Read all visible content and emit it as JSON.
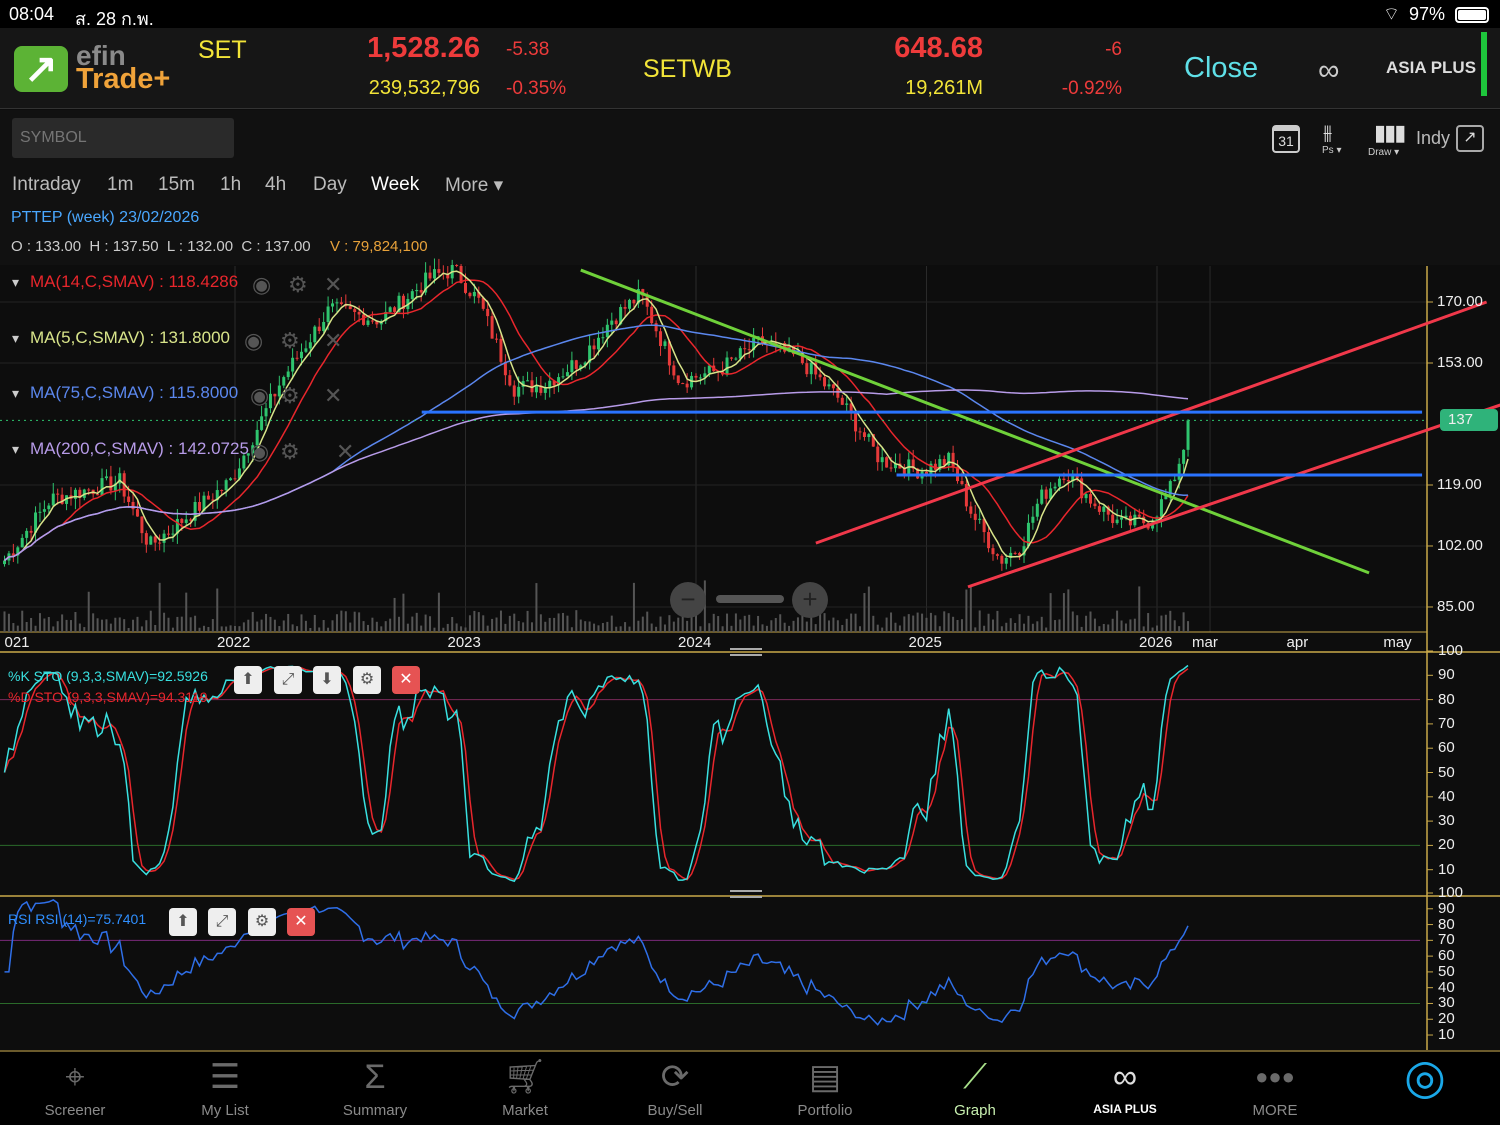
{
  "status_bar": {
    "time": "08:04",
    "date": "ส. 28 ก.พ.",
    "battery": "97%"
  },
  "header": {
    "logo_top": "efin",
    "logo_bottom": "Trade+",
    "set": {
      "label": "SET",
      "value": "1,528.26",
      "change": "-5.38",
      "volume": "239,532,796",
      "percent": "-0.35%"
    },
    "setwb": {
      "label": "SETWB",
      "value": "648.68",
      "change": "-6",
      "volume": "19,261M",
      "percent": "-0.92%"
    },
    "market_status": "Close",
    "broker_logo": "ASIA PLUS"
  },
  "toolbar": {
    "symbol_placeholder": "SYMBOL",
    "calendar_day": "31",
    "ps_label": "Ps ▾",
    "draw_label": "Draw ▾",
    "indy_label": "Indy",
    "timeframes": [
      "Intraday",
      "1m",
      "15m",
      "1h",
      "4h",
      "Day",
      "Week",
      "More ▾"
    ],
    "active_timeframe": "Week"
  },
  "info": {
    "title": "PTTEP (week) 23/02/2026",
    "ohlc": "O : 133.00  H : 137.50  L : 132.00  C : 137.00",
    "volume": "V : 79,824,100"
  },
  "colors": {
    "up": "#2fc46e",
    "down": "#e63a3a",
    "ma14": "#e8262c",
    "ma5": "#d8e48a",
    "ma75": "#5b87ee",
    "ma200": "#b79be8",
    "trend_green": "#6fd13a",
    "trend_red": "#f0384a",
    "level_blue": "#2a73ff",
    "stoK": "#39e0e0",
    "stoD": "#e8262c",
    "rsi": "#2f6fe8",
    "axis": "#c9a94a"
  },
  "chart_data": [
    {
      "type": "candlestick",
      "title": "PTTEP (week)",
      "ylim": [
        80,
        180
      ],
      "yticks": [
        "170.00",
        "153.00",
        "119.00",
        "102.00",
        "85.00"
      ],
      "ytick_values": [
        170,
        153,
        119,
        102,
        85
      ],
      "xticks": [
        "021",
        "2022",
        "2023",
        "2024",
        "2025",
        "2026",
        "mar",
        "apr",
        "may"
      ],
      "xtick_values": [
        2021.0,
        2022,
        2023,
        2024,
        2025,
        2026,
        2026.23,
        2026.64,
        2027.06
      ],
      "last_price_label": "137",
      "close_keypoints": [
        [
          2021.0,
          98
        ],
        [
          2021.2,
          115
        ],
        [
          2021.5,
          120
        ],
        [
          2021.63,
          102
        ],
        [
          2021.98,
          120
        ],
        [
          2022.2,
          148
        ],
        [
          2022.41,
          168
        ],
        [
          2022.63,
          165
        ],
        [
          2022.85,
          177
        ],
        [
          2022.95,
          179
        ],
        [
          2023.06,
          170
        ],
        [
          2023.21,
          146
        ],
        [
          2023.34,
          147
        ],
        [
          2023.5,
          154
        ],
        [
          2023.63,
          165
        ],
        [
          2023.76,
          172
        ],
        [
          2023.93,
          148
        ],
        [
          2024.1,
          151
        ],
        [
          2024.28,
          159
        ],
        [
          2024.45,
          154
        ],
        [
          2024.62,
          143
        ],
        [
          2024.8,
          126
        ],
        [
          2024.97,
          123
        ],
        [
          2025.1,
          126
        ],
        [
          2025.19,
          112
        ],
        [
          2025.32,
          98
        ],
        [
          2025.41,
          102
        ],
        [
          2025.49,
          115
        ],
        [
          2025.6,
          123
        ],
        [
          2025.71,
          115
        ],
        [
          2025.84,
          108
        ],
        [
          2025.97,
          109
        ],
        [
          2026.06,
          118
        ],
        [
          2026.15,
          137
        ]
      ],
      "legend": [
        {
          "name": "MA(14,C,SMAV) : 118.4286",
          "period": 14,
          "color_key": "ma14"
        },
        {
          "name": "MA(5,C,SMAV) : 131.8000",
          "period": 5,
          "color_key": "ma5"
        },
        {
          "name": "MA(75,C,SMAV) : 115.8000",
          "period": 75,
          "color_key": "ma75"
        },
        {
          "name": "MA(200,C,SMAV) : 142.0725",
          "period": 200,
          "color_key": "ma200"
        }
      ],
      "trendlines": [
        {
          "color_key": "trend_green",
          "from": [
            2023.5,
            178.9
          ],
          "to": [
            2026.92,
            94.5
          ]
        },
        {
          "color_key": "trend_red",
          "from": [
            2024.52,
            102.8
          ],
          "to": [
            2027.43,
            170
          ]
        },
        {
          "color_key": "trend_red",
          "from": [
            2025.18,
            90.6
          ],
          "to": [
            2027.49,
            141.3
          ]
        },
        {
          "color_key": "level_blue",
          "from": [
            2022.81,
            139.3
          ],
          "to": [
            2027.15,
            139.3
          ]
        },
        {
          "color_key": "level_blue",
          "from": [
            2024.87,
            121.8
          ],
          "to": [
            2027.15,
            121.8
          ]
        }
      ]
    },
    {
      "type": "line",
      "title": "Stochastic",
      "legend": [
        "%K STO (9,3,3,SMAV)=92.5926",
        "%D STO (9,3,3,SMAV)=94.3119"
      ],
      "ylim": [
        0,
        100
      ],
      "yticks": [
        "100",
        "90",
        "80",
        "70",
        "60",
        "50",
        "40",
        "30",
        "20",
        "10"
      ],
      "levels": [
        80,
        20
      ]
    },
    {
      "type": "line",
      "title": "RSI",
      "legend": [
        "RSI RSI (14)=75.7401"
      ],
      "ylim": [
        0,
        100
      ],
      "yticks": [
        "100",
        "90",
        "80",
        "70",
        "60",
        "50",
        "40",
        "30",
        "20",
        "10"
      ],
      "levels": [
        70,
        30
      ]
    }
  ],
  "nav": [
    {
      "label": "Screener",
      "icon": "crosshair-icon"
    },
    {
      "label": "My List",
      "icon": "list-icon"
    },
    {
      "label": "Summary",
      "icon": "sigma-icon"
    },
    {
      "label": "Market",
      "icon": "cart-icon"
    },
    {
      "label": "Buy/Sell",
      "icon": "exchange-icon"
    },
    {
      "label": "Portfolio",
      "icon": "portfolio-icon"
    },
    {
      "label": "Graph",
      "icon": "graph-icon"
    },
    {
      "label": "ASIA PLUS",
      "icon": "asiaplus-icon"
    },
    {
      "label": "MORE",
      "icon": "more-icon"
    },
    {
      "label": "",
      "icon": "assistant-icon"
    }
  ],
  "active_nav": "Graph"
}
